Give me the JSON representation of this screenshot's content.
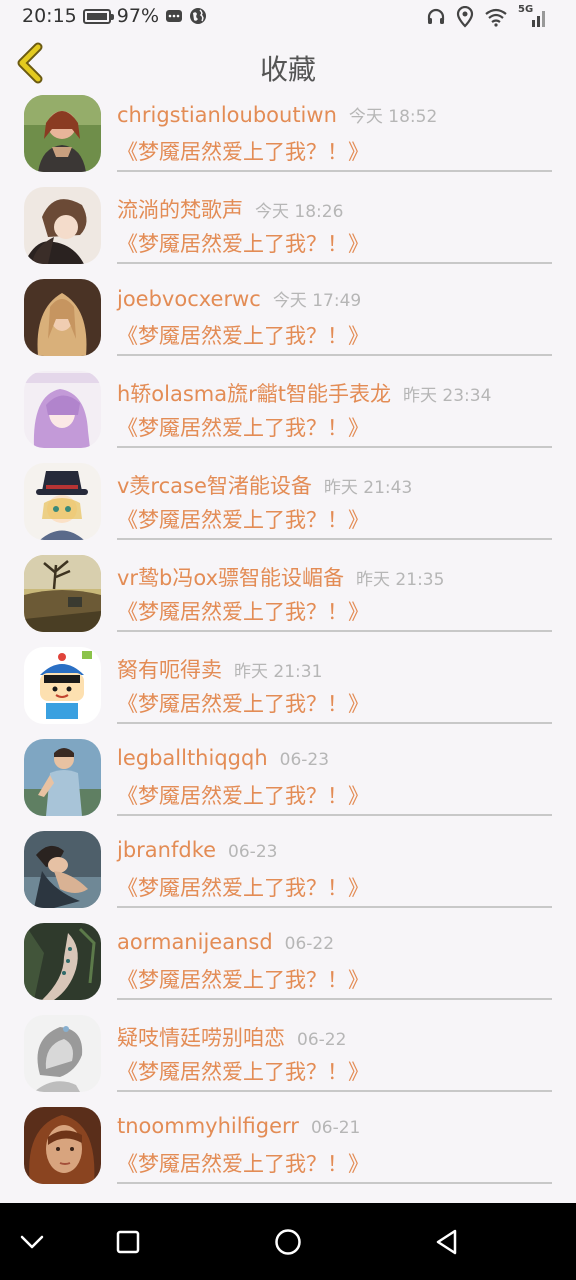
{
  "status": {
    "time": "20:15",
    "battery": "97%",
    "network": "5G"
  },
  "header": {
    "title": "收藏"
  },
  "colors": {
    "accent": "#e38c55",
    "back_arrow": "#d9c01d",
    "time_text": "#b6b6b6",
    "background": "#f7f5f8"
  },
  "items": [
    {
      "name": "chrigstianlouboutiwn",
      "time": "今天 18:52",
      "title": "《梦魇居然爱上了我？！》"
    },
    {
      "name": "流淌的梵歌声",
      "time": "今天 18:26",
      "title": "《梦魇居然爱上了我？！》"
    },
    {
      "name": "joebvocxerwc",
      "time": "今天 17:49",
      "title": "《梦魇居然爱上了我？！》"
    },
    {
      "name": "h轿olasma旒r龤t智能手表龙",
      "time": "昨天 23:34",
      "title": "《梦魇居然爱上了我？！》"
    },
    {
      "name": "v羡rcase智渚能设备",
      "time": "昨天 21:43",
      "title": "《梦魇居然爱上了我？！》"
    },
    {
      "name": "vr鸷b冯ox骠智能设嵋备",
      "time": "昨天 21:35",
      "title": "《梦魇居然爱上了我？！》"
    },
    {
      "name": "胬有呃得卖",
      "time": "昨天 21:31",
      "title": "《梦魇居然爱上了我？！》"
    },
    {
      "name": "legballthiqgqh",
      "time": "06-23",
      "title": "《梦魇居然爱上了我？！》"
    },
    {
      "name": "jbranfdke",
      "time": "06-23",
      "title": "《梦魇居然爱上了我？！》"
    },
    {
      "name": "aormanijeansd",
      "time": "06-22",
      "title": "《梦魇居然爱上了我？！》"
    },
    {
      "name": "疑吱情廷唠别咱恋",
      "time": "06-22",
      "title": "《梦魇居然爱上了我？！》"
    },
    {
      "name": "tnoommyhilfigerr",
      "time": "06-21",
      "title": "《梦魇居然爱上了我？！》"
    }
  ],
  "nav": {
    "icons": [
      "chevron-down-icon",
      "square-icon",
      "circle-icon",
      "triangle-back-icon"
    ]
  }
}
